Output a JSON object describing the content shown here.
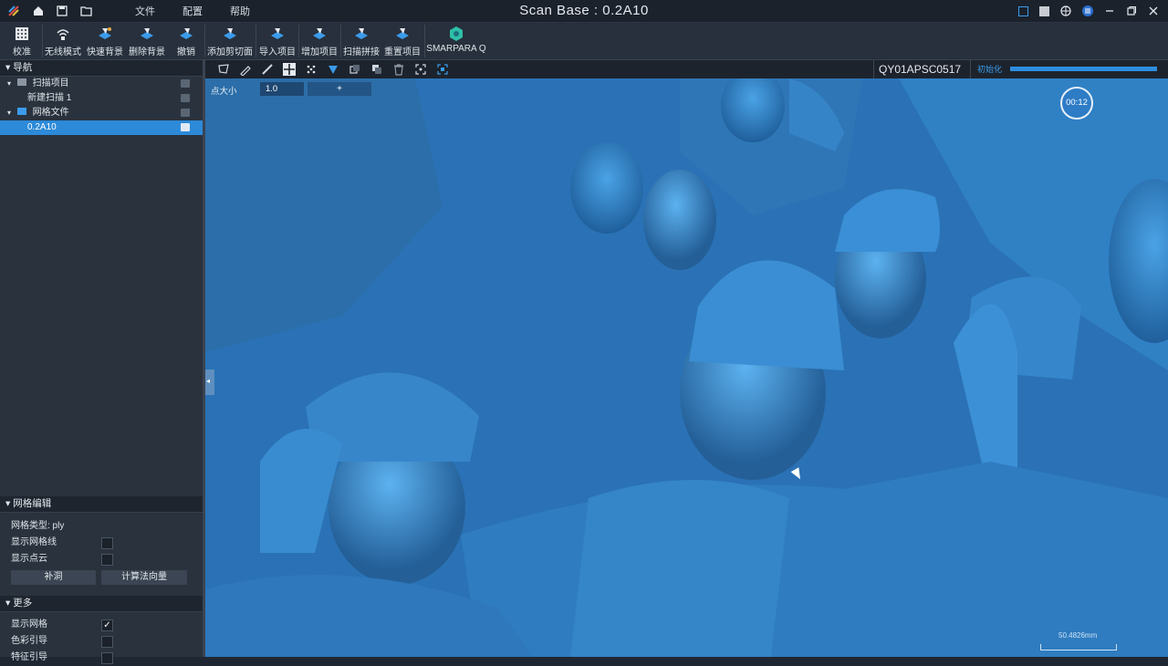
{
  "app": {
    "title": "Scan Base : 0.2A10"
  },
  "menu": {
    "file": "文件",
    "config": "配置",
    "help": "帮助"
  },
  "toolbar": {
    "items": [
      "校准",
      "无线模式",
      "快速背景",
      "删除背景",
      "撤销",
      "添加剪切面",
      "导入项目",
      "增加项目",
      "扫描拼接",
      "重置项目",
      "SMARPARA Q"
    ]
  },
  "nav": {
    "header": "导航",
    "scan_project": "扫描项目",
    "new_scan": "新建扫描 1",
    "mesh_file": "网格文件",
    "selected_file": "0.2A10"
  },
  "mesh_edit": {
    "header": "网格编辑",
    "mesh_type": "网格类型: ply",
    "show_wireframe": "显示网格线",
    "show_points": "显示点云",
    "fill_holes": "补洞",
    "compute_normals": "计算法向量"
  },
  "more": {
    "header": "更多",
    "show_mesh": "显示网格",
    "color_guide": "色彩引导",
    "feature_guide": "特征引导",
    "show_mesh_checked": true
  },
  "viewport": {
    "point_size_label": "点大小",
    "point_size_value": "1.0",
    "plus": "+",
    "timer": "00:12",
    "scale": "50.4826mm"
  },
  "status": {
    "device_id": "QY01APSC0517",
    "init_label": "初始化",
    "progress": 1.0
  },
  "colors": {
    "accent": "#2c8ad8",
    "mesh": "#2f7fc6"
  }
}
